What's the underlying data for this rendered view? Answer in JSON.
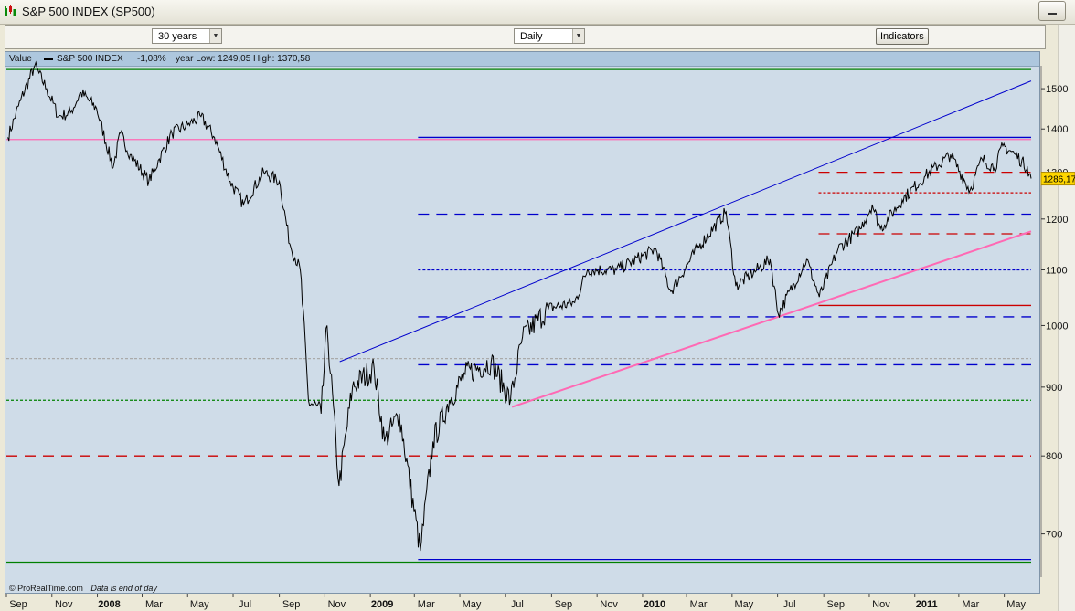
{
  "window": {
    "title": "S&P 500 INDEX (SP500)"
  },
  "toolbar": {
    "range_select": "30 years",
    "interval_select": "Daily",
    "indicators_button": "Indicators"
  },
  "legend": {
    "value_label": "Value",
    "series_name": "S&P 500 INDEX",
    "change": "-1,08%",
    "year_low_high": "year Low: 1249,05 High: 1370,58"
  },
  "footer": {
    "source": "© ProRealTime.com",
    "note": "Data is end of day"
  },
  "colors": {
    "plot_bg": "#cfdce8",
    "price": "#000000",
    "channel": "#0000cc",
    "support": "#ff69b4",
    "last_price_tag": "#ffd700"
  },
  "chart_data": {
    "type": "line",
    "title": "S&P 500 INDEX (SP500)",
    "y_scale": "log",
    "ylim": [
      650,
      1560
    ],
    "y_ticks": [
      700,
      800,
      900,
      1000,
      1100,
      1200,
      1300,
      1400,
      1500
    ],
    "x_range": [
      "2007-09-01",
      "2011-06-06"
    ],
    "x_tick_labels": [
      "Sep",
      "Nov",
      "2008",
      "Mar",
      "May",
      "Jul",
      "Sep",
      "Nov",
      "2009",
      "Mar",
      "May",
      "Jul",
      "Sep",
      "Nov",
      "2010",
      "Mar",
      "May",
      "Jul",
      "Sep",
      "Nov",
      "2011",
      "Mar",
      "May"
    ],
    "last_price_label": "1286,17",
    "series": [
      {
        "name": "S&P 500 INDEX",
        "x": [
          "2007-09-03",
          "2007-09-20",
          "2007-10-09",
          "2007-10-25",
          "2007-11-10",
          "2007-11-26",
          "2007-12-10",
          "2007-12-31",
          "2008-01-22",
          "2008-02-01",
          "2008-02-14",
          "2008-03-10",
          "2008-03-24",
          "2008-04-10",
          "2008-05-01",
          "2008-05-19",
          "2008-06-06",
          "2008-06-27",
          "2008-07-15",
          "2008-08-11",
          "2008-09-01",
          "2008-09-15",
          "2008-09-29",
          "2008-10-10",
          "2008-10-27",
          "2008-11-04",
          "2008-11-20",
          "2008-12-08",
          "2009-01-06",
          "2009-01-20",
          "2009-02-09",
          "2009-03-09",
          "2009-03-26",
          "2009-04-17",
          "2009-05-08",
          "2009-06-12",
          "2009-07-08",
          "2009-07-24",
          "2009-08-28",
          "2009-10-02",
          "2009-10-19",
          "2009-11-27",
          "2010-01-19",
          "2010-02-08",
          "2010-03-15",
          "2010-04-23",
          "2010-05-06",
          "2010-05-25",
          "2010-06-21",
          "2010-07-02",
          "2010-08-09",
          "2010-08-26",
          "2010-09-20",
          "2010-10-20",
          "2010-11-05",
          "2010-11-16",
          "2010-12-15",
          "2011-01-14",
          "2011-02-18",
          "2011-03-16",
          "2011-04-01",
          "2011-04-18",
          "2011-04-29",
          "2011-05-16",
          "2011-06-01",
          "2011-06-06"
        ],
        "values": [
          1380,
          1470,
          1560,
          1500,
          1430,
          1440,
          1490,
          1450,
          1310,
          1390,
          1340,
          1280,
          1330,
          1390,
          1410,
          1430,
          1380,
          1280,
          1230,
          1300,
          1280,
          1150,
          1100,
          880,
          860,
          1000,
          760,
          900,
          930,
          820,
          860,
          680,
          820,
          880,
          920,
          940,
          880,
          980,
          1030,
          1040,
          1100,
          1100,
          1140,
          1060,
          1140,
          1215,
          1070,
          1090,
          1120,
          1020,
          1120,
          1050,
          1140,
          1180,
          1230,
          1180,
          1240,
          1290,
          1340,
          1260,
          1330,
          1310,
          1360,
          1340,
          1310,
          1286
        ]
      }
    ],
    "horizontal_lines": [
      {
        "y": 1550,
        "color": "#008000",
        "style": "solid",
        "from": "2007-09-01"
      },
      {
        "y": 1375,
        "color": "#ff69b4",
        "style": "solid",
        "from": "2007-09-01"
      },
      {
        "y": 1380,
        "color": "#0000cc",
        "style": "solid",
        "from": "2009-03-06"
      },
      {
        "y": 1300,
        "color": "#cc0000",
        "style": "dashed",
        "from": "2010-08-25"
      },
      {
        "y": 1255,
        "color": "#cc0000",
        "style": "dotted",
        "from": "2010-08-25"
      },
      {
        "y": 1210,
        "color": "#0000cc",
        "style": "dashed",
        "from": "2009-03-06"
      },
      {
        "y": 1170,
        "color": "#cc0000",
        "style": "dashed",
        "from": "2010-08-25"
      },
      {
        "y": 1100,
        "color": "#0000cc",
        "style": "dotted",
        "from": "2009-03-06"
      },
      {
        "y": 1035,
        "color": "#cc0000",
        "style": "solid",
        "from": "2010-08-25"
      },
      {
        "y": 1015,
        "color": "#0000cc",
        "style": "dashed",
        "from": "2009-03-06"
      },
      {
        "y": 945,
        "color": "#aaaaaa",
        "style": "dotted",
        "from": "2007-09-01"
      },
      {
        "y": 935,
        "color": "#0000cc",
        "style": "dashed",
        "from": "2009-03-06"
      },
      {
        "y": 880,
        "color": "#008000",
        "style": "dotted",
        "from": "2007-09-01"
      },
      {
        "y": 800,
        "color": "#cc0000",
        "style": "dashed",
        "from": "2007-09-01"
      },
      {
        "y": 667,
        "color": "#008000",
        "style": "solid",
        "from": "2007-09-01"
      },
      {
        "y": 670,
        "color": "#0000cc",
        "style": "solid",
        "from": "2009-03-06"
      }
    ],
    "trendlines": [
      {
        "color": "#0000cc",
        "from": [
          "2008-11-21",
          940
        ],
        "to": [
          "2011-06-06",
          1520
        ]
      },
      {
        "color": "#ff69b4",
        "from": [
          "2009-07-10",
          870
        ],
        "to": [
          "2011-06-06",
          1175
        ]
      }
    ]
  }
}
